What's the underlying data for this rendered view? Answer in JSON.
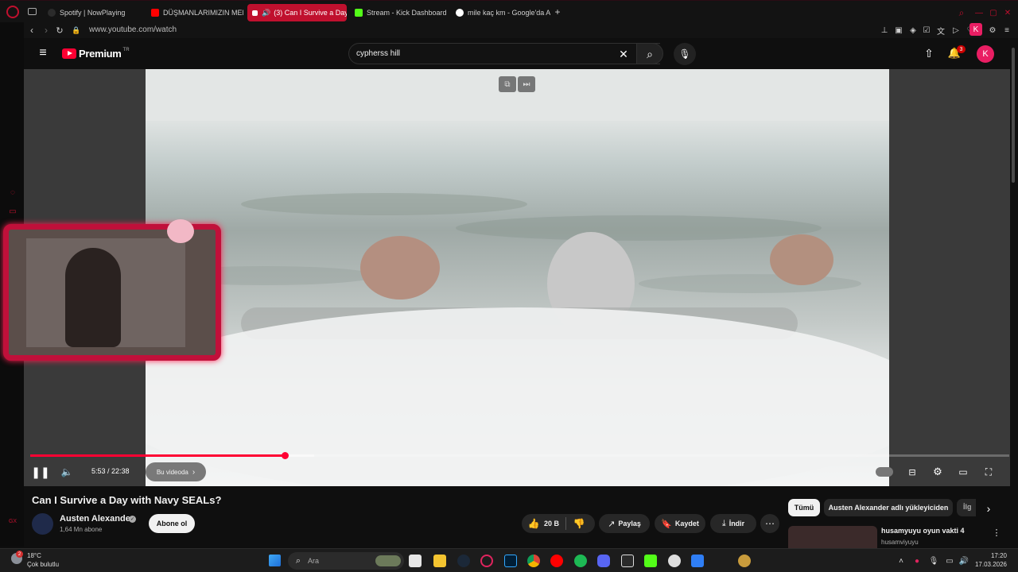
{
  "browser": {
    "tabs": [
      {
        "label": "Spotify | NowPlaying",
        "favicon_color": "#1db954"
      },
      {
        "label": "DÜŞMANLARIMIZIN MEKA",
        "favicon_color": "#ff0000"
      },
      {
        "label": "(3) Can I Survive a Day",
        "favicon_color": "#ff0000",
        "active": true
      },
      {
        "label": "Stream - Kick Dashboard",
        "favicon_color": "#53fc18"
      },
      {
        "label": "mile kaç km - Google'da A",
        "favicon_color": "#4285f4"
      }
    ],
    "url": "www.youtube.com/watch",
    "profile_letter": "K"
  },
  "youtube": {
    "logo": "Premium",
    "logo_region": "TR",
    "search_value": "cypherss hill",
    "notification_count": "3",
    "avatar_letter": "K"
  },
  "player": {
    "time": "5:53 / 22:38",
    "chapter_chip": "Bu videoda",
    "progress_fraction": 0.26,
    "buffer_fraction": 0.29
  },
  "video": {
    "title": "Can I Survive a Day with Navy SEALs?",
    "channel": "Austen Alexander",
    "subscribers": "1,64 Mn abone",
    "subscribe_label": "Abone ol",
    "likes": "20 B",
    "share_label": "Paylaş",
    "save_label": "Kaydet",
    "download_label": "İndir"
  },
  "chips": [
    "Tümü",
    "Austen Alexander adlı yükleyiciden",
    "İlg"
  ],
  "related": {
    "title": "husamyuyu oyun vakti 4",
    "channel": "husamviyuyu"
  },
  "taskbar": {
    "temperature": "18°C",
    "weather": "Çok bulutlu",
    "weather_badge": "2",
    "search": "Ara",
    "time": "17:20",
    "date": "17.03.2026"
  },
  "colors": {
    "accent": "#ff0033",
    "opera_red": "#c0102e",
    "avatar_pink": "#e91e63"
  }
}
